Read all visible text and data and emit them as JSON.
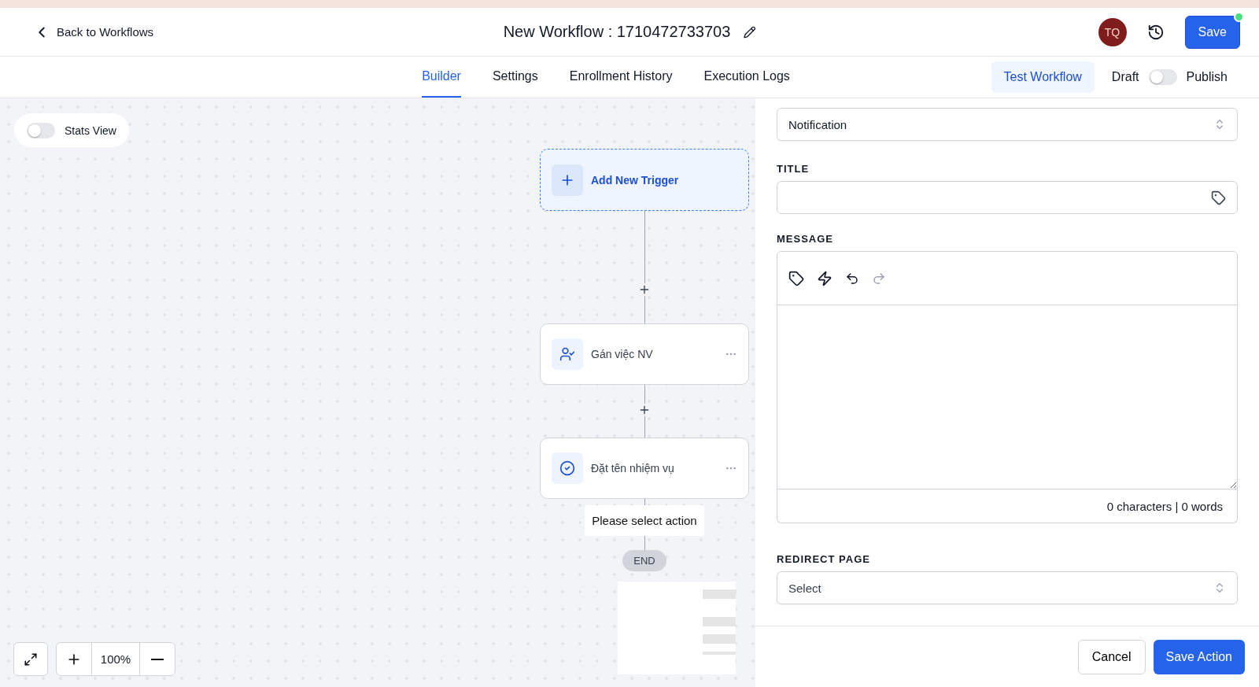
{
  "header": {
    "back_link": "Back to Workflows",
    "title": "New Workflow : 1710472733703",
    "avatar": "TQ",
    "save_button": "Save"
  },
  "tabs": [
    {
      "label": "Builder",
      "selected": true
    },
    {
      "label": "Settings",
      "selected": false
    },
    {
      "label": "Enrollment History",
      "selected": false
    },
    {
      "label": "Execution Logs",
      "selected": false
    }
  ],
  "test_button": "Test Workflow",
  "publish_toggle": {
    "off_label": "Draft",
    "on_label": "Publish",
    "on": false
  },
  "canvas": {
    "stats_toggle": {
      "label": "Stats View",
      "on": false
    },
    "trigger": "Add New Trigger",
    "actions": [
      {
        "kind": "assign",
        "label": "Gán việc NV"
      },
      {
        "kind": "task",
        "label": "Đặt tên nhiệm vụ"
      }
    ],
    "placeholder": "Please select action",
    "end": "END",
    "zoom": "100%"
  },
  "panel": {
    "action_type": "Notification",
    "title_label": "TITLE",
    "message_label": "MESSAGE",
    "counter": "0 characters | 0 words",
    "redirect_label": "REDIRECT PAGE",
    "redirect_placeholder": "Select",
    "cancel": "Cancel",
    "save": "Save Action"
  }
}
